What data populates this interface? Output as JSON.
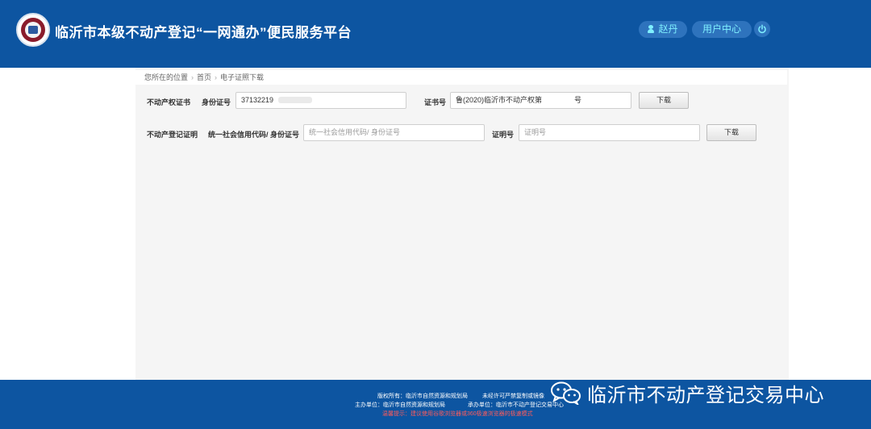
{
  "header": {
    "title": "临沂市本级不动产登记“一网通办”便民服务平台",
    "user_name": "赵丹",
    "user_center": "用户中心"
  },
  "breadcrumb": {
    "prefix": "您所在的位置",
    "home": "首页",
    "current": "电子证照下载"
  },
  "row1": {
    "section": "不动产权证书",
    "id_label": "身份证号",
    "id_value": "37132219",
    "cert_label": "证书号",
    "cert_value": "鲁(2020)临沂市不动产权第",
    "cert_suffix": "号",
    "download": "下载"
  },
  "row2": {
    "section": "不动产登记证明",
    "code_label": "统一社会信用代码/ 身份证号",
    "code_placeholder": "统一社会信用代码/ 身份证号",
    "proof_label": "证明号",
    "proof_placeholder": "证明号",
    "download": "下载"
  },
  "footer": {
    "copyright": "版权所有：临沂市自然资源和规划局",
    "no_copy": "未经许可严禁复制或镜像",
    "sponsor": "主办单位：临沂市自然资源和规划局",
    "operator": "承办单位：临沂市不动产登记交易中心",
    "warning": "温馨提示：建议使用谷歌浏览器或360极速浏览器的极速模式"
  },
  "watermark": {
    "text": "临沂市不动产登记交易中心"
  },
  "colors": {
    "brand_blue": "#0d55a1",
    "accent_cyan": "#7ff0ff",
    "warning_red": "#ff5b5b"
  },
  "icons": {
    "logo": "emblem-logo",
    "user": "user-icon",
    "power": "power-icon",
    "wechat": "wechat-icon"
  }
}
